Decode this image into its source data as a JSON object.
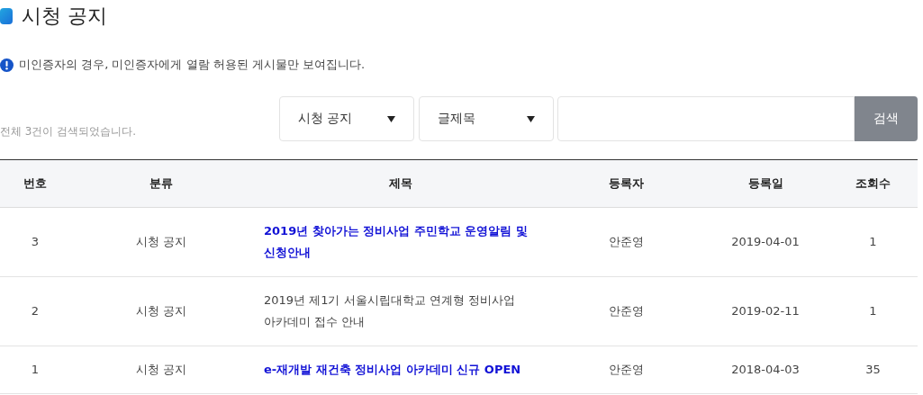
{
  "page_title": "시청 공지",
  "notice": "미인증자의 경우, 미인증자에게 열람 허용된 게시물만 보여집니다.",
  "result_count": "전체 3건이 검색되었습니다.",
  "search": {
    "category": "시청 공지",
    "field": "글제목",
    "button": "검색"
  },
  "table": {
    "columns": [
      "번호",
      "분류",
      "제목",
      "등록자",
      "등록일",
      "조회수"
    ],
    "rows": [
      {
        "number": "3",
        "category": "시청 공지",
        "title": "2019년 찾아가는 정비사업 주민학교 운영알림 및 신청안내",
        "highlighted": true,
        "author": "안준영",
        "date": "2019-04-01",
        "views": "1"
      },
      {
        "number": "2",
        "category": "시청 공지",
        "title": "2019년 제1기 서울시립대학교 연계형 정비사업 아카데미 접수 안내",
        "highlighted": false,
        "author": "안준영",
        "date": "2019-02-11",
        "views": "1"
      },
      {
        "number": "1",
        "category": "시청 공지",
        "title": "e-재개발 재건축 정비사업 아카데미 신규 OPEN",
        "highlighted": true,
        "author": "안준영",
        "date": "2018-04-03",
        "views": "35"
      }
    ]
  }
}
